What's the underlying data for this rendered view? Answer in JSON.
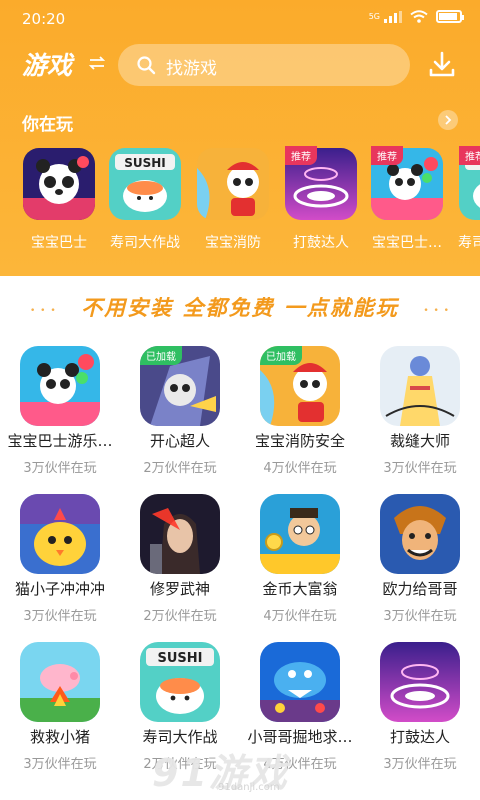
{
  "status": {
    "time": "20:20",
    "network": "5G",
    "battery_level": 0.9
  },
  "header": {
    "brand": "游戏",
    "search_placeholder": "找游戏"
  },
  "recent": {
    "title": "你在玩",
    "items": [
      {
        "label": "宝宝巴士",
        "tag": ""
      },
      {
        "label": "寿司大作战",
        "tag": ""
      },
      {
        "label": "宝宝消防",
        "tag": ""
      },
      {
        "label": "打鼓达人",
        "tag": "推荐"
      },
      {
        "label": "宝宝巴士…",
        "tag": "推荐"
      },
      {
        "label": "寿司",
        "tag": "推荐"
      }
    ]
  },
  "slogan": "不用安装  全都免费  一点就能玩",
  "games": [
    {
      "name": "宝宝巴士游乐…",
      "players": "3万伙伴在玩",
      "badge": ""
    },
    {
      "name": "开心超人",
      "players": "2万伙伴在玩",
      "badge": "已加载"
    },
    {
      "name": "宝宝消防安全",
      "players": "4万伙伴在玩",
      "badge": "已加载"
    },
    {
      "name": "裁缝大师",
      "players": "3万伙伴在玩",
      "badge": ""
    },
    {
      "name": "猫小子冲冲冲",
      "players": "3万伙伴在玩",
      "badge": ""
    },
    {
      "name": "修罗武神",
      "players": "2万伙伴在玩",
      "badge": ""
    },
    {
      "name": "金币大富翁",
      "players": "4万伙伴在玩",
      "badge": ""
    },
    {
      "name": "欧力给哥哥",
      "players": "3万伙伴在玩",
      "badge": ""
    },
    {
      "name": "救救小猪",
      "players": "3万伙伴在玩",
      "badge": ""
    },
    {
      "name": "寿司大作战",
      "players": "2万伙伴在玩",
      "badge": ""
    },
    {
      "name": "小哥哥掘地求…",
      "players": "4万伙伴在玩",
      "badge": ""
    },
    {
      "name": "打鼓达人",
      "players": "3万伙伴在玩",
      "badge": ""
    }
  ],
  "watermark": {
    "brand": "91游戏",
    "url": "91danji.com"
  }
}
